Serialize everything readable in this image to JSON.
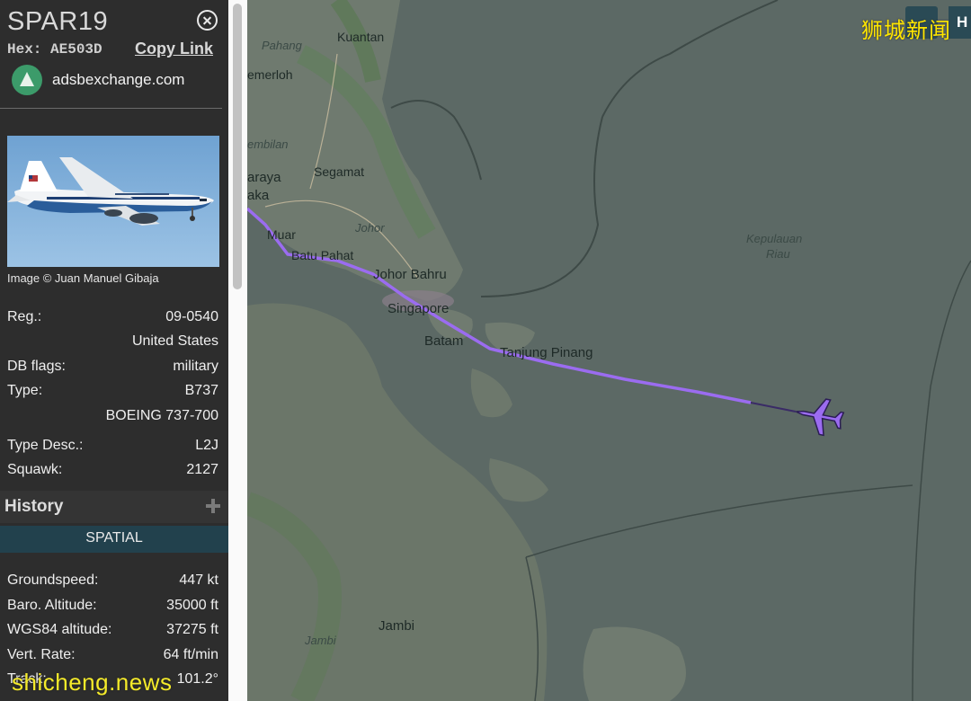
{
  "sidebar": {
    "callsign": "SPAR19",
    "hex_label": "Hex: AE503D",
    "copy_link": "Copy Link",
    "site_name": "adsbexchange.com",
    "image_credit": "Image © Juan Manuel Gibaja",
    "info_rows": [
      {
        "label": "Reg.:",
        "value": "09-0540"
      },
      {
        "label": "",
        "value": "United States"
      },
      {
        "label": "DB flags:",
        "value": "military"
      },
      {
        "label": "Type:",
        "value": "B737"
      },
      {
        "label": "",
        "value": "BOEING 737-700"
      },
      {
        "label": "Type Desc.:",
        "value": "L2J"
      },
      {
        "label": "Squawk:",
        "value": "2127"
      }
    ],
    "history_title": "History",
    "spatial_tab": "SPATIAL",
    "spatial_rows": [
      {
        "label": "Groundspeed:",
        "value": "447 kt"
      },
      {
        "label": "Baro. Altitude:",
        "value": "35000 ft"
      },
      {
        "label": "WGS84 altitude:",
        "value": "37275 ft"
      },
      {
        "label": "Vert. Rate:",
        "value": "64 ft/min"
      },
      {
        "label": "Track:",
        "value": "101.2°"
      }
    ]
  },
  "map": {
    "places": {
      "kuantan": "Kuantan",
      "pahang": "Pahang",
      "temerloh": "emerloh",
      "sembilan": "embilan",
      "segamat": "Segamat",
      "araya": "araya",
      "aka": "aka",
      "johor": "Johor",
      "muar": "Muar",
      "batu_pahat": "Batu Pahat",
      "johor_bahru": "Johor Bahru",
      "singapore": "Singapore",
      "batam": "Batam",
      "tanjung_pinang": "Tanjung Pinang",
      "kepulauan": "Kepulauan",
      "riau": "Riau",
      "jambi_city": "Jambi",
      "jambi_region": "Jambi"
    },
    "track_color": "#9b6cf0",
    "aircraft_color": "#9b6cf0",
    "h_button": "H"
  },
  "watermarks": {
    "top_right": "狮城新闻",
    "bottom_left": "shicheng.news"
  }
}
